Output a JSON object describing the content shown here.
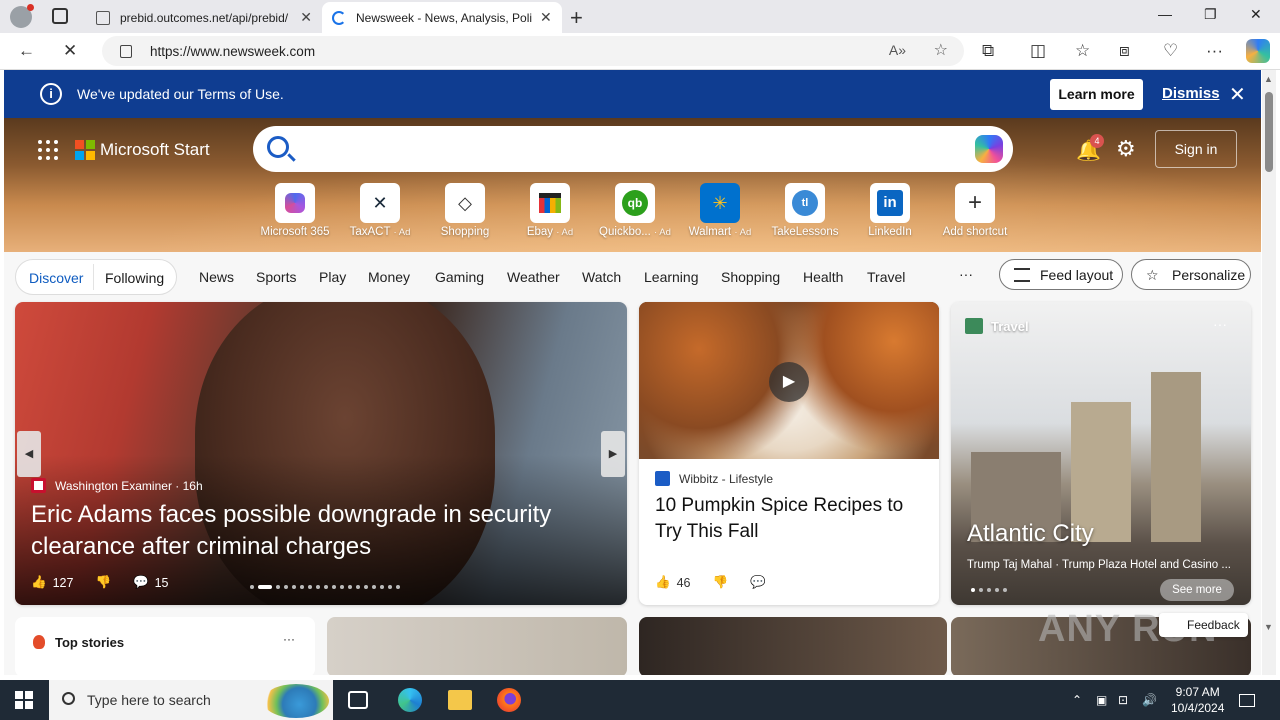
{
  "browser": {
    "tabs": [
      {
        "title": "prebid.outcomes.net/api/prebid/"
      },
      {
        "title": "Newsweek - News, Analysis, Polit"
      }
    ],
    "url": "https://www.newsweek.com"
  },
  "notice": {
    "message": "We've updated our Terms of Use.",
    "learn_more": "Learn more",
    "dismiss": "Dismiss"
  },
  "header": {
    "brand": "Microsoft Start",
    "notification_count": "4",
    "sign_in": "Sign in"
  },
  "shortcuts": [
    {
      "label": "Microsoft 365",
      "ad": ""
    },
    {
      "label": "TaxACT",
      "ad": "· Ad"
    },
    {
      "label": "Shopping",
      "ad": ""
    },
    {
      "label": "Ebay",
      "ad": "· Ad"
    },
    {
      "label": "Quickbo...",
      "ad": "· Ad"
    },
    {
      "label": "Walmart",
      "ad": "· Ad"
    },
    {
      "label": "TakeLessons",
      "ad": ""
    },
    {
      "label": "LinkedIn",
      "ad": ""
    },
    {
      "label": "Add shortcut",
      "ad": ""
    }
  ],
  "nav": {
    "discover": "Discover",
    "following": "Following",
    "items": [
      "News",
      "Sports",
      "Play",
      "Money",
      "Gaming",
      "Weather",
      "Watch",
      "Learning",
      "Shopping",
      "Health",
      "Travel"
    ],
    "more": "···",
    "feed_layout": "Feed layout",
    "personalize": "Personalize"
  },
  "main_story": {
    "source": "Washington Examiner",
    "age": "· 16h",
    "headline": "Eric Adams faces possible downgrade in security clearance after criminal charges",
    "likes": "127",
    "comments": "15"
  },
  "mid_story": {
    "source": "Wibbitz - Lifestyle",
    "headline": "10 Pumpkin Spice Recipes to Try This Fall",
    "likes": "46"
  },
  "travel": {
    "label": "Travel",
    "place": "Atlantic City",
    "subtitle": "Trump Taj Mahal · Trump Plaza Hotel and Casino ...",
    "see_more": "See more"
  },
  "row2": {
    "top_stories": "Top stories",
    "more": "···"
  },
  "feedback": "Feedback",
  "watermark": "ANY RUN",
  "taskbar": {
    "search_placeholder": "Type here to search",
    "time": "9:07 AM",
    "date": "10/4/2024"
  }
}
